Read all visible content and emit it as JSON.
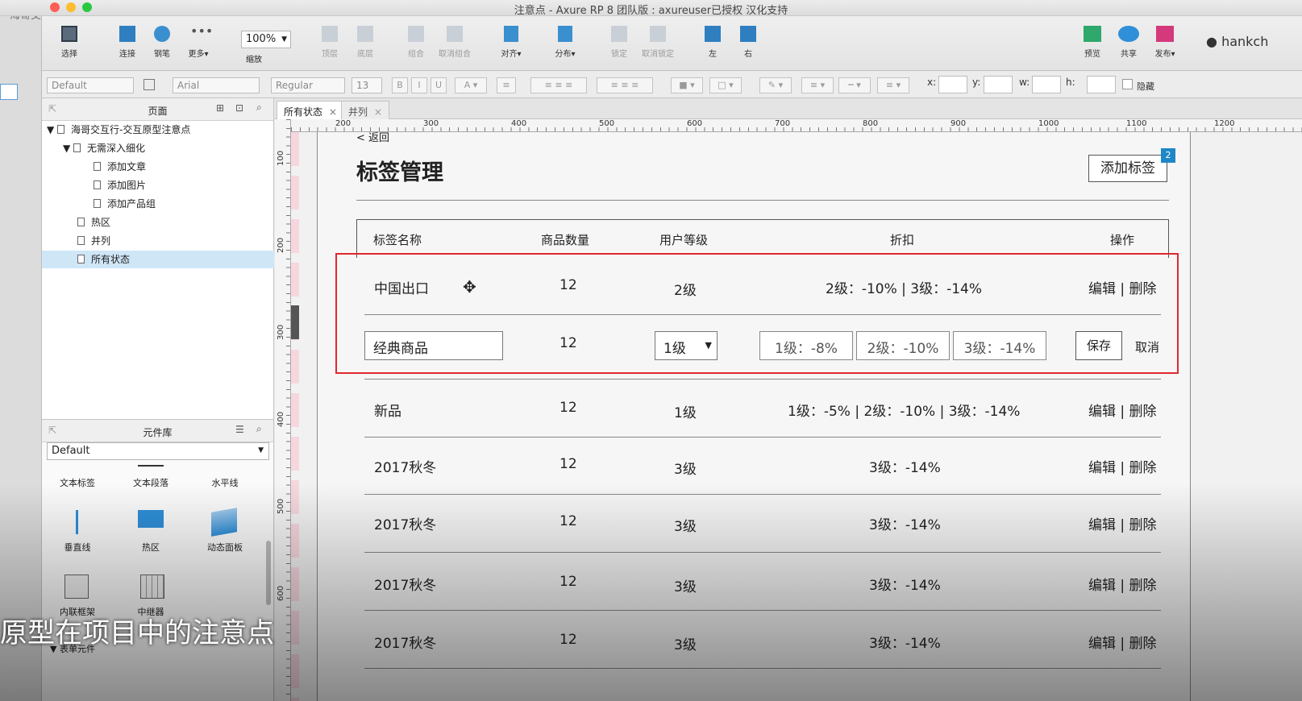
{
  "window": {
    "title": "注意点 - Axure RP 8 团队版 : axureuser已授权 汉化支持",
    "user": "hankch",
    "left_strip_text": "海哥交"
  },
  "toolbar": {
    "select": "选择",
    "connect": "连接",
    "pen": "钢笔",
    "more": "更多▾",
    "zoom_value": "100%",
    "zoom_label": "缩放",
    "top": "顶层",
    "bottom": "底层",
    "group": "组合",
    "ungroup": "取消组合",
    "align": "对齐▾",
    "distribute": "分布▾",
    "lock": "锁定",
    "unlock": "取消锁定",
    "left": "左",
    "right": "右",
    "preview": "预览",
    "share": "共享",
    "publish": "发布▾"
  },
  "formatbar": {
    "style": "Default",
    "font": "Arial",
    "weight": "Regular",
    "size": "13",
    "x_label": "x:",
    "y_label": "y:",
    "w_label": "w:",
    "h_label": "h:",
    "hidden_label": "隐藏"
  },
  "pages": {
    "title": "页面",
    "items": [
      {
        "label": "海哥交互行-交互原型注意点"
      },
      {
        "label": "无需深入细化"
      },
      {
        "label": "添加文章"
      },
      {
        "label": "添加图片"
      },
      {
        "label": "添加产品组"
      },
      {
        "label": "热区"
      },
      {
        "label": "并列"
      },
      {
        "label": "所有状态"
      }
    ]
  },
  "widgets": {
    "title": "元件库",
    "library": "Default",
    "items": [
      "文本标签",
      "文本段落",
      "水平线",
      "垂直线",
      "热区",
      "动态面板",
      "内联框架",
      "中继器"
    ],
    "form_section": "表单元件"
  },
  "tabs": [
    {
      "label": "所有状态",
      "close": "×"
    },
    {
      "label": "并列",
      "close": "×"
    }
  ],
  "ruler": {
    "h": [
      "200",
      "300",
      "400",
      "500",
      "600",
      "700",
      "800",
      "900",
      "1000",
      "1100",
      "1200"
    ],
    "v": [
      "100",
      "200",
      "300",
      "400",
      "500",
      "600"
    ]
  },
  "page": {
    "back": "< 返回",
    "heading": "标签管理",
    "add_button": "添加标签",
    "badge": "2",
    "columns": [
      "标签名称",
      "商品数量",
      "用户等级",
      "折扣",
      "操作"
    ],
    "rows": [
      {
        "name": "中国出口",
        "count": "12",
        "level": "2级",
        "discount": "2级：-10%  |  3级：-14%",
        "action": "编辑 | 删除"
      },
      {
        "name": "新品",
        "count": "12",
        "level": "1级",
        "discount": "1级：-5%  |  2级：-10%  |  3级：-14%",
        "action": "编辑 | 删除"
      },
      {
        "name": "2017秋冬",
        "count": "12",
        "level": "3级",
        "discount": "3级：-14%",
        "action": "编辑 | 删除"
      },
      {
        "name": "2017秋冬",
        "count": "12",
        "level": "3级",
        "discount": "3级：-14%",
        "action": "编辑 | 删除"
      },
      {
        "name": "2017秋冬",
        "count": "12",
        "level": "3级",
        "discount": "3级：-14%",
        "action": "编辑 | 删除"
      },
      {
        "name": "2017秋冬",
        "count": "12",
        "level": "3级",
        "discount": "3级：-14%",
        "action": "编辑 | 删除"
      }
    ],
    "edit_row": {
      "name": "经典商品",
      "count": "12",
      "level": "1级",
      "d1": "1级：-8%",
      "d2": "2级：-10%",
      "d3": "3级：-14%",
      "save": "保存",
      "cancel": "取消"
    }
  },
  "caption": "原型在项目中的注意点",
  "colors": {
    "highlight": "#e0282e",
    "accent": "#1e88c7",
    "selected_page": "#cfe6f7"
  }
}
